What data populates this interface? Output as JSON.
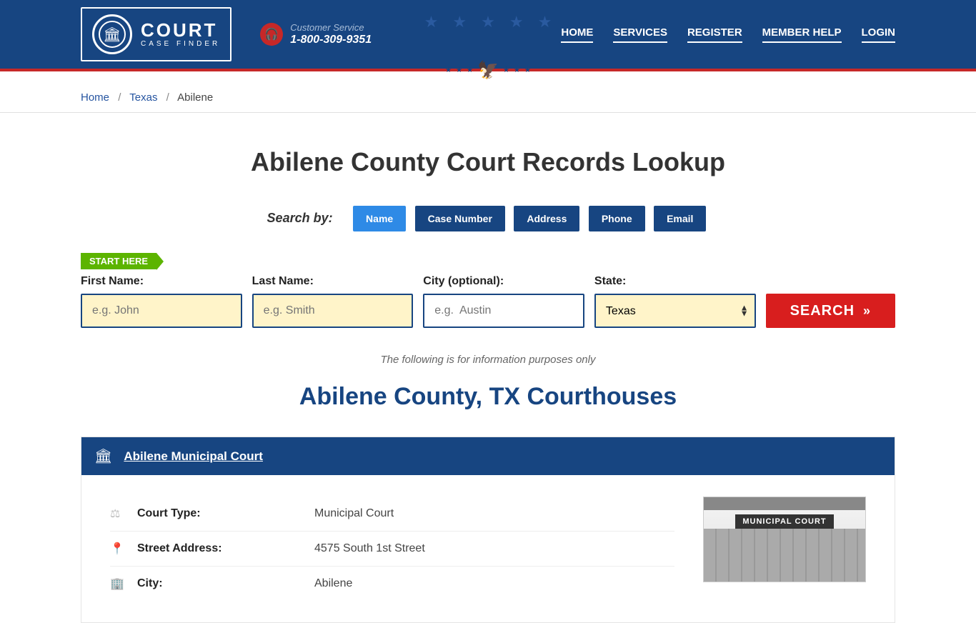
{
  "header": {
    "logo_main": "COURT",
    "logo_sub": "CASE FINDER",
    "cs_label": "Customer Service",
    "cs_phone": "1-800-309-9351"
  },
  "nav": {
    "home": "HOME",
    "services": "SERVICES",
    "register": "REGISTER",
    "help": "MEMBER HELP",
    "login": "LOGIN"
  },
  "breadcrumb": {
    "home": "Home",
    "state": "Texas",
    "current": "Abilene"
  },
  "page_title": "Abilene County Court Records Lookup",
  "search_by_label": "Search by:",
  "tabs": {
    "name": "Name",
    "case": "Case Number",
    "address": "Address",
    "phone": "Phone",
    "email": "Email"
  },
  "start_here": "START HERE",
  "form": {
    "first_name_label": "First Name:",
    "first_name_placeholder": "e.g. John",
    "last_name_label": "Last Name:",
    "last_name_placeholder": "e.g. Smith",
    "city_label": "City (optional):",
    "city_placeholder": "e.g.  Austin",
    "state_label": "State:",
    "state_value": "Texas",
    "search_button": "SEARCH"
  },
  "info_note": "The following is for information purposes only",
  "sub_title": "Abilene County, TX Courthouses",
  "court": {
    "name": "Abilene Municipal Court",
    "rows": {
      "type_label": "Court Type:",
      "type_value": "Municipal Court",
      "street_label": "Street Address:",
      "street_value": "4575 South 1st Street",
      "city_label": "City:",
      "city_value": "Abilene"
    },
    "image_sign": "MUNICIPAL COURT"
  }
}
